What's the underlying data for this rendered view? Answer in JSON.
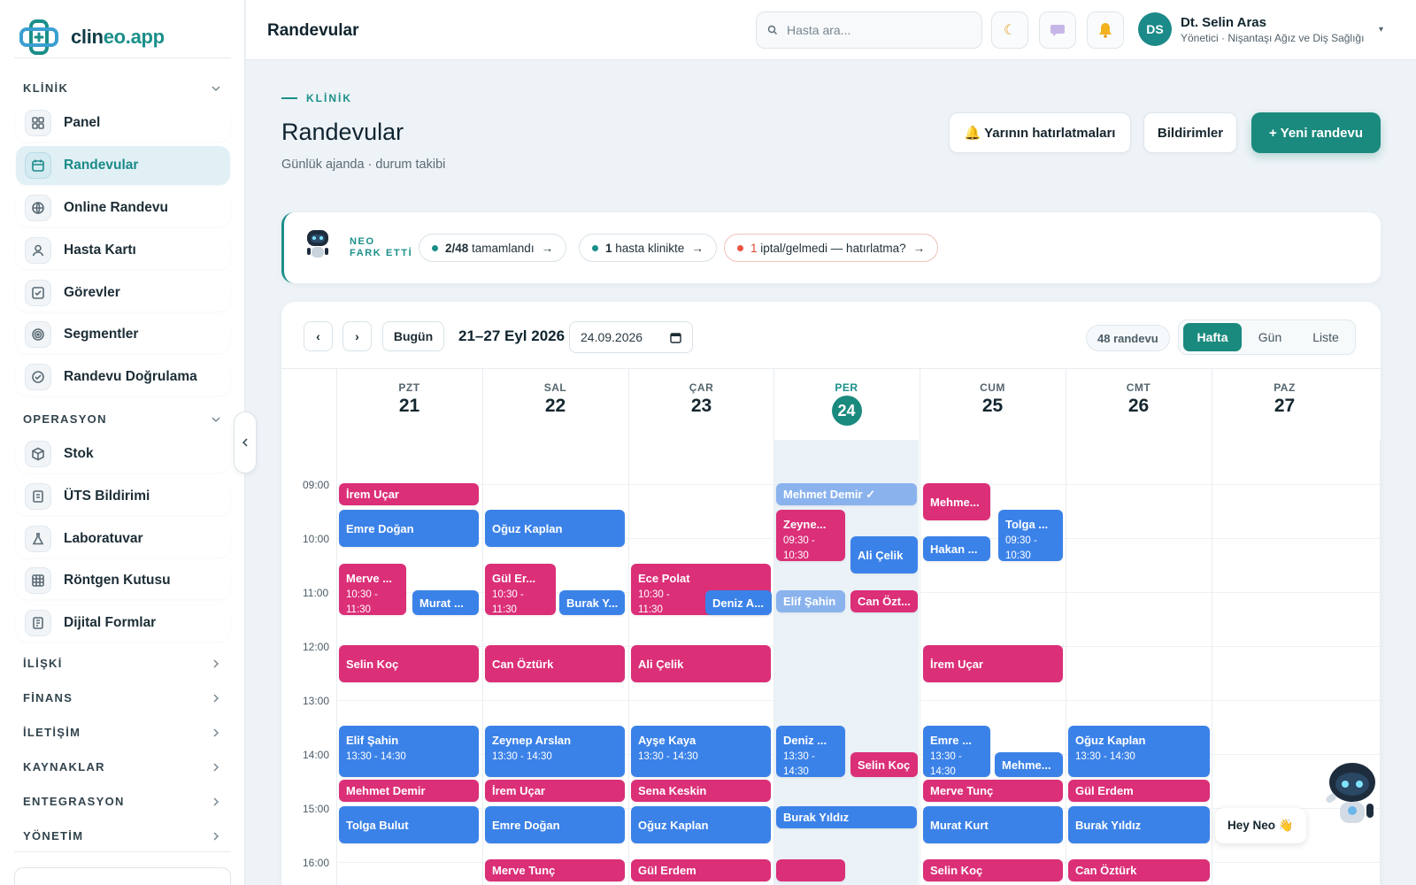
{
  "brand": {
    "name_main": "clin",
    "name_accent": "eo.app",
    "accent_color": "#1b8f8a"
  },
  "sidebar": {
    "sections": [
      {
        "label": "KLİNİK",
        "items": [
          {
            "label": "Panel",
            "icon": "grid-icon"
          },
          {
            "label": "Randevular",
            "icon": "calendar-icon",
            "active": true
          },
          {
            "label": "Online Randevu",
            "icon": "globe-icon"
          },
          {
            "label": "Hasta Kartı",
            "icon": "user-icon"
          },
          {
            "label": "Görevler",
            "icon": "checkbox-icon"
          },
          {
            "label": "Segmentler",
            "icon": "target-icon"
          },
          {
            "label": "Randevu Doğrulama",
            "icon": "check-circle-icon"
          }
        ]
      },
      {
        "label": "OPERASYON",
        "items": [
          {
            "label": "Stok",
            "icon": "box-icon"
          },
          {
            "label": "ÜTS Bildirimi",
            "icon": "document-icon"
          },
          {
            "label": "Laboratuvar",
            "icon": "flask-icon"
          },
          {
            "label": "Röntgen Kutusu",
            "icon": "grid-box-icon"
          },
          {
            "label": "Dijital Formlar",
            "icon": "form-icon"
          }
        ]
      },
      {
        "label": "İLİŞKİ",
        "items": []
      },
      {
        "label": "FİNANS",
        "items": []
      },
      {
        "label": "İLETİŞİM",
        "items": []
      },
      {
        "label": "KAYNAKLAR",
        "items": []
      },
      {
        "label": "ENTEGRASYON",
        "items": []
      },
      {
        "label": "YÖNETİM",
        "items": []
      }
    ]
  },
  "topbar": {
    "title": "Randevular",
    "search_placeholder": "Hasta ara...",
    "user": {
      "initials": "DS",
      "name": "Dt. Selin Aras",
      "role": "Yönetici · Nişantaşı Ağız ve Diş Sağlığı"
    }
  },
  "header": {
    "eyebrow": "KLİNİK",
    "title": "Randevular",
    "subtitle": "Günlük ajanda · durum takibi",
    "reminders_label": "🔔 Yarının hatırlatmaları",
    "notifications_label": "Bildirimler",
    "new_label": "+ Yeni randevu"
  },
  "neo": {
    "label_line1": "NEO",
    "label_line2": "FARK ETTİ",
    "pill1": {
      "strong": "2/48",
      "text": " tamamlandı",
      "arrow": "→"
    },
    "pill2": {
      "strong": "1",
      "text": " hasta klinikte",
      "arrow": "→"
    },
    "pill3": {
      "num": "1",
      "text": " iptal/gelmedi — hatırlatma?",
      "arrow": "→"
    }
  },
  "calendar": {
    "prev": "‹",
    "next": "›",
    "today_label": "Bugün",
    "range": "21–27 Eyl 2026",
    "date_value": "24.09.2026",
    "count": "48 randevu",
    "views": [
      "Hafta",
      "Gün",
      "Liste"
    ],
    "active_view": "Hafta",
    "days": [
      {
        "name": "PZT",
        "num": "21"
      },
      {
        "name": "SAL",
        "num": "22"
      },
      {
        "name": "ÇAR",
        "num": "23"
      },
      {
        "name": "PER",
        "num": "24",
        "today": true
      },
      {
        "name": "CUM",
        "num": "25"
      },
      {
        "name": "CMT",
        "num": "26"
      },
      {
        "name": "PAZ",
        "num": "27"
      }
    ],
    "hours": [
      "09:00",
      "10:00",
      "11:00",
      "12:00",
      "13:00",
      "14:00",
      "15:00",
      "16:00"
    ],
    "colors": {
      "blue": "#3b82e8",
      "pink": "#db2f78"
    },
    "appointments": [
      {
        "day": 0,
        "name": "İrem Uçar",
        "color": "pink"
      },
      {
        "day": 0,
        "name": "Emre Doğan",
        "color": "blue"
      },
      {
        "day": 0,
        "name": "Merve ...",
        "time": "10:30 -",
        "time2": "11:30",
        "color": "pink"
      },
      {
        "day": 0,
        "name": "Murat ...",
        "color": "blue"
      },
      {
        "day": 0,
        "name": "Selin Koç",
        "color": "pink"
      },
      {
        "day": 0,
        "name": "Elif Şahin",
        "time": "13:30 - 14:30",
        "color": "blue"
      },
      {
        "day": 0,
        "name": "Mehmet Demir",
        "color": "pink"
      },
      {
        "day": 0,
        "name": "Tolga Bulut",
        "color": "blue"
      },
      {
        "day": 1,
        "name": "Oğuz Kaplan",
        "color": "blue"
      },
      {
        "day": 1,
        "name": "Gül Er...",
        "time": "10:30 -",
        "time2": "11:30",
        "color": "pink"
      },
      {
        "day": 1,
        "name": "Burak Y...",
        "color": "blue"
      },
      {
        "day": 1,
        "name": "Can Öztürk",
        "color": "pink"
      },
      {
        "day": 1,
        "name": "Zeynep Arslan",
        "time": "13:30 - 14:30",
        "color": "blue"
      },
      {
        "day": 1,
        "name": "İrem Uçar",
        "color": "pink"
      },
      {
        "day": 1,
        "name": "Emre Doğan",
        "color": "blue"
      },
      {
        "day": 1,
        "name": "Merve Tunç",
        "color": "pink"
      },
      {
        "day": 2,
        "name": "Ece Polat",
        "time": "10:30 -",
        "time2": "11:30",
        "color": "pink"
      },
      {
        "day": 2,
        "name": "Deniz A...",
        "color": "blue"
      },
      {
        "day": 2,
        "name": "Ali Çelik",
        "color": "pink"
      },
      {
        "day": 2,
        "name": "Ayşe Kaya",
        "time": "13:30 - 14:30",
        "color": "blue"
      },
      {
        "day": 2,
        "name": "Sena Keskin",
        "color": "pink"
      },
      {
        "day": 2,
        "name": "Oğuz Kaplan",
        "color": "blue"
      },
      {
        "day": 2,
        "name": "Gül Erdem",
        "color": "pink"
      },
      {
        "day": 3,
        "name": "Mehmet Demir ✓",
        "color": "faded"
      },
      {
        "day": 3,
        "name": "Zeyne...",
        "time": "09:30 -",
        "time2": "10:30",
        "color": "pink"
      },
      {
        "day": 3,
        "name": "Ali Çelik",
        "color": "blue"
      },
      {
        "day": 3,
        "name": "Elif Şahin",
        "color": "faded"
      },
      {
        "day": 3,
        "name": "Can Özt...",
        "color": "pink"
      },
      {
        "day": 3,
        "name": "Deniz ...",
        "time": "13:30 -",
        "time2": "14:30",
        "color": "blue"
      },
      {
        "day": 3,
        "name": "Selin Koç",
        "color": "pink"
      },
      {
        "day": 3,
        "name": "Burak Yıldız",
        "color": "blue"
      },
      {
        "day": 3,
        "name": "",
        "color": "pink"
      },
      {
        "day": 4,
        "name": "Mehme...",
        "color": "pink"
      },
      {
        "day": 4,
        "name": "Tolga ...",
        "time": "09:30 -",
        "time2": "10:30",
        "color": "blue"
      },
      {
        "day": 4,
        "name": "Hakan ...",
        "color": "blue"
      },
      {
        "day": 4,
        "name": "İrem Uçar",
        "color": "pink"
      },
      {
        "day": 4,
        "name": "Emre ...",
        "time": "13:30 -",
        "time2": "14:30",
        "color": "blue"
      },
      {
        "day": 4,
        "name": "Mehme...",
        "color": "blue"
      },
      {
        "day": 4,
        "name": "Merve Tunç",
        "color": "pink"
      },
      {
        "day": 4,
        "name": "Murat Kurt",
        "color": "blue"
      },
      {
        "day": 4,
        "name": "Selin Koç",
        "color": "pink"
      },
      {
        "day": 5,
        "name": "Oğuz Kaplan",
        "time": "13:30 - 14:30",
        "color": "blue"
      },
      {
        "day": 5,
        "name": "Gül Erdem",
        "color": "pink"
      },
      {
        "day": 5,
        "name": "Burak Yıldız",
        "color": "blue"
      },
      {
        "day": 5,
        "name": "Can Öztürk",
        "color": "pink"
      }
    ]
  },
  "assistant": {
    "greeting": "Hey Neo 👋"
  }
}
